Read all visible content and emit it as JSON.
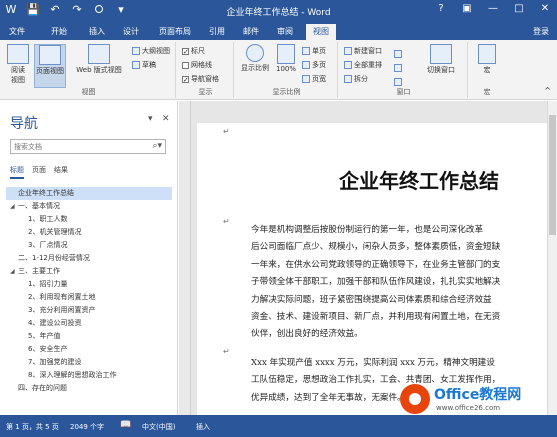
{
  "app": {
    "window_title": "企业年终工作总结 - Word",
    "qat": [
      "W",
      "💾",
      "↶",
      "↷",
      "⭘",
      "▾"
    ],
    "win_controls": [
      "?",
      "▣",
      "—",
      "□",
      "✕"
    ]
  },
  "tabs": {
    "file": "文件",
    "items": [
      "开始",
      "插入",
      "设计",
      "页面布局",
      "引用",
      "邮件",
      "审阅",
      "视图"
    ],
    "active": "视图",
    "login": "登录"
  },
  "ribbon": {
    "view_group": {
      "label": "视图",
      "read_mode": "阅读\n视图",
      "print_layout": "页面视图",
      "web_layout": "Web 版式视图",
      "outline": "大纲视图",
      "draft": "草稿"
    },
    "show_group": {
      "label": "显示",
      "ruler": "标尺",
      "gridlines": "网格线",
      "nav_pane": "导航窗格",
      "ruler_checked": "✓",
      "nav_checked": "✓"
    },
    "zoom_group": {
      "label": "显示比例",
      "zoom": "显示比例",
      "hundred": "100%",
      "one_page": "单页",
      "multi_page": "多页",
      "page_width": "页宽"
    },
    "window_group": {
      "label": "窗口",
      "new_window": "新建窗口",
      "arrange_all": "全部重排",
      "split": "拆分",
      "switch_windows": "切换窗口"
    },
    "macro_group": {
      "label": "宏",
      "macros": "宏"
    }
  },
  "nav": {
    "title": "导航",
    "search_placeholder": "搜索文档",
    "tabs": [
      "标题",
      "页面",
      "结果"
    ],
    "headings": [
      {
        "text": "企业年终工作总结",
        "level": 0,
        "tri": "",
        "selected": true
      },
      {
        "text": "一、基本情况",
        "level": 0,
        "tri": "◢",
        "selected": false
      },
      {
        "text": "1、职工人数",
        "level": 1,
        "tri": "",
        "selected": false
      },
      {
        "text": "2、机关管理情况",
        "level": 1,
        "tri": "",
        "selected": false
      },
      {
        "text": "3、厂点情况",
        "level": 1,
        "tri": "",
        "selected": false
      },
      {
        "text": "二、1-12月份经营情况",
        "level": 0,
        "tri": "",
        "selected": false
      },
      {
        "text": "三、主要工作",
        "level": 0,
        "tri": "◢",
        "selected": false
      },
      {
        "text": "1、招引力量",
        "level": 1,
        "tri": "",
        "selected": false
      },
      {
        "text": "2、利用现有闲置土地",
        "level": 1,
        "tri": "",
        "selected": false
      },
      {
        "text": "3、充分利用闲置资产",
        "level": 1,
        "tri": "",
        "selected": false
      },
      {
        "text": "4、建设公司投资",
        "level": 1,
        "tri": "",
        "selected": false
      },
      {
        "text": "5、年产值",
        "level": 1,
        "tri": "",
        "selected": false
      },
      {
        "text": "6、安全生产",
        "level": 1,
        "tri": "",
        "selected": false
      },
      {
        "text": "7、加强党的建设",
        "level": 1,
        "tri": "",
        "selected": false
      },
      {
        "text": "8、深入理解的思想政治工作",
        "level": 1,
        "tri": "",
        "selected": false
      },
      {
        "text": "四、存在的问题",
        "level": 0,
        "tri": "",
        "selected": false
      }
    ]
  },
  "doc": {
    "title": "企业年终工作总结",
    "return_mark": "↵",
    "para1": [
      "今年是机构调整后按股份制运行的第一年，也是公司深化改革",
      "后公司面临厂点少、规模小，闲杂人员多，整体素质低，资金短缺",
      "一年来，在供水公司党政领导的正确领导下，在业务主管部门的支",
      "子带领全体干部职工，加强干部和队伍作风建设，扎扎实实地解决",
      "力解决实际问题，班子紧密围绕提高公司体素质和综合经济效益",
      "资金、技术、建设新项目、新厂点，并利用现有闲置土地，在无资",
      "伙伴，创出良好的经济效益。"
    ],
    "para2": [
      "Xxx 年实现产值 xxxx 万元，实际利润 xxx 万元，精神文明建设",
      "工队伍稳定，思想政治工作扎实，工会、共青团、女工发挥作用，",
      "优异成绩，达到了全年无事故，无案件。"
    ]
  },
  "status": {
    "page": "第 1 页，共 5 页",
    "words": "2049 个字",
    "proof_icon": "📖",
    "lang": "中文(中国)",
    "insert": "插入"
  },
  "watermark": {
    "main": "Office教程网",
    "sub": "www.office26.com"
  }
}
